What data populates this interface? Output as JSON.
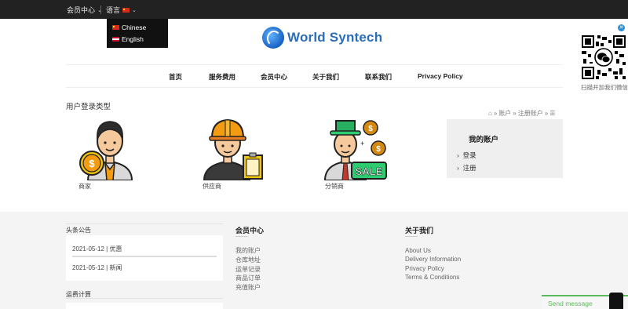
{
  "topbar": {
    "member_center": "会员中心",
    "language": "语言",
    "dropdown": {
      "chinese": "Chinese",
      "english": "English"
    }
  },
  "logo": {
    "text": "World Syntech"
  },
  "nav": {
    "items": [
      "首页",
      "服务费用",
      "会员中心",
      "关于我们",
      "联系我们",
      "Privacy Policy"
    ]
  },
  "page": {
    "title": "用户登录类型",
    "breadcrumb": [
      "账户",
      "注册账户"
    ]
  },
  "user_types": [
    {
      "label": "商家",
      "icon": "merchant-icon"
    },
    {
      "label": "供应商",
      "icon": "supplier-icon"
    },
    {
      "label": "分销商",
      "icon": "distributor-icon",
      "badge": "SALE"
    }
  ],
  "sidebar": {
    "title": "我的账户",
    "links": [
      "登录",
      "注册"
    ]
  },
  "footer": {
    "news": {
      "label": "头条公告",
      "items": [
        "2021-05-12 | 优惠",
        "2021-05-12 | 新闻"
      ]
    },
    "shipping": {
      "label": "运费计算"
    },
    "member": {
      "title": "会员中心",
      "links": [
        "我的账户",
        "仓库地址",
        "运单记录",
        "商品订单",
        "充值账户"
      ]
    },
    "about": {
      "title": "关于我们",
      "links": [
        "About Us",
        "Delivery Information",
        "Privacy Policy",
        "Terms & Conditions"
      ]
    }
  },
  "qr": {
    "caption": "扫描并加我们微信"
  },
  "chat": {
    "label": "Send message"
  },
  "colors": {
    "topbar": "#222222",
    "accent_blue": "#2a6db8",
    "chat_green": "#5cb85c"
  }
}
